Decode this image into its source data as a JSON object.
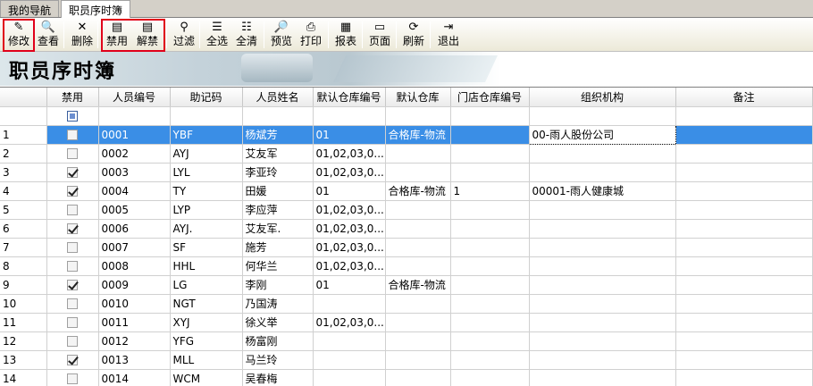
{
  "tabs": [
    {
      "label": "我的导航",
      "active": false
    },
    {
      "label": "职员序时簿",
      "active": true
    }
  ],
  "toolbar": {
    "edit": "修改",
    "view": "查看",
    "delete": "删除",
    "disable": "禁用",
    "enable": "解禁",
    "filter": "过滤",
    "select_all": "全选",
    "clear_all": "全清",
    "preview": "预览",
    "print": "打印",
    "report": "报表",
    "page": "页面",
    "refresh": "刷新",
    "exit": "退出"
  },
  "banner": {
    "title": "职员序时簿"
  },
  "grid": {
    "columns": [
      "",
      "禁用",
      "人员编号",
      "助记码",
      "人员姓名",
      "默认仓库编号",
      "默认仓库",
      "门店仓库编号",
      "组织机构",
      "备注"
    ],
    "rows": [
      {
        "n": "1",
        "disabled": false,
        "code": "0001",
        "mnemonic": "YBF",
        "name": "杨斌芳",
        "wh_code": "01",
        "warehouse": "合格库-物流",
        "store_wh": "",
        "org": "00-雨人股份公司",
        "note": ""
      },
      {
        "n": "2",
        "disabled": false,
        "code": "0002",
        "mnemonic": "AYJ",
        "name": "艾友军",
        "wh_code": "01,02,03,0...",
        "warehouse": "",
        "store_wh": "",
        "org": "",
        "note": ""
      },
      {
        "n": "3",
        "disabled": true,
        "code": "0003",
        "mnemonic": "LYL",
        "name": "李亚玲",
        "wh_code": "01,02,03,0...",
        "warehouse": "",
        "store_wh": "",
        "org": "",
        "note": ""
      },
      {
        "n": "4",
        "disabled": true,
        "code": "0004",
        "mnemonic": "TY",
        "name": "田媛",
        "wh_code": "01",
        "warehouse": "合格库-物流",
        "store_wh": "1",
        "org": "00001-雨人健康城",
        "note": ""
      },
      {
        "n": "5",
        "disabled": false,
        "code": "0005",
        "mnemonic": "LYP",
        "name": "李应萍",
        "wh_code": "01,02,03,0...",
        "warehouse": "",
        "store_wh": "",
        "org": "",
        "note": ""
      },
      {
        "n": "6",
        "disabled": true,
        "code": "0006",
        "mnemonic": "AYJ.",
        "name": "艾友军.",
        "wh_code": "01,02,03,0...",
        "warehouse": "",
        "store_wh": "",
        "org": "",
        "note": ""
      },
      {
        "n": "7",
        "disabled": false,
        "code": "0007",
        "mnemonic": "SF",
        "name": "施芳",
        "wh_code": "01,02,03,0...",
        "warehouse": "",
        "store_wh": "",
        "org": "",
        "note": ""
      },
      {
        "n": "8",
        "disabled": false,
        "code": "0008",
        "mnemonic": "HHL",
        "name": "何华兰",
        "wh_code": "01,02,03,0...",
        "warehouse": "",
        "store_wh": "",
        "org": "",
        "note": ""
      },
      {
        "n": "9",
        "disabled": true,
        "code": "0009",
        "mnemonic": "LG",
        "name": "李刚",
        "wh_code": "01",
        "warehouse": "合格库-物流",
        "store_wh": "",
        "org": "",
        "note": ""
      },
      {
        "n": "10",
        "disabled": false,
        "code": "0010",
        "mnemonic": "NGT",
        "name": "乃国涛",
        "wh_code": "",
        "warehouse": "",
        "store_wh": "",
        "org": "",
        "note": ""
      },
      {
        "n": "11",
        "disabled": false,
        "code": "0011",
        "mnemonic": "XYJ",
        "name": "徐义举",
        "wh_code": "01,02,03,0...",
        "warehouse": "",
        "store_wh": "",
        "org": "",
        "note": ""
      },
      {
        "n": "12",
        "disabled": false,
        "code": "0012",
        "mnemonic": "YFG",
        "name": "杨富刚",
        "wh_code": "",
        "warehouse": "",
        "store_wh": "",
        "org": "",
        "note": ""
      },
      {
        "n": "13",
        "disabled": true,
        "code": "0013",
        "mnemonic": "MLL",
        "name": "马兰玲",
        "wh_code": "",
        "warehouse": "",
        "store_wh": "",
        "org": "",
        "note": ""
      },
      {
        "n": "14",
        "disabled": false,
        "code": "0014",
        "mnemonic": "WCM",
        "name": "吴春梅",
        "wh_code": "",
        "warehouse": "",
        "store_wh": "",
        "org": "",
        "note": ""
      }
    ]
  },
  "colors": {
    "selection": "#3a8ee6",
    "highlight_box": "#e0001a"
  }
}
